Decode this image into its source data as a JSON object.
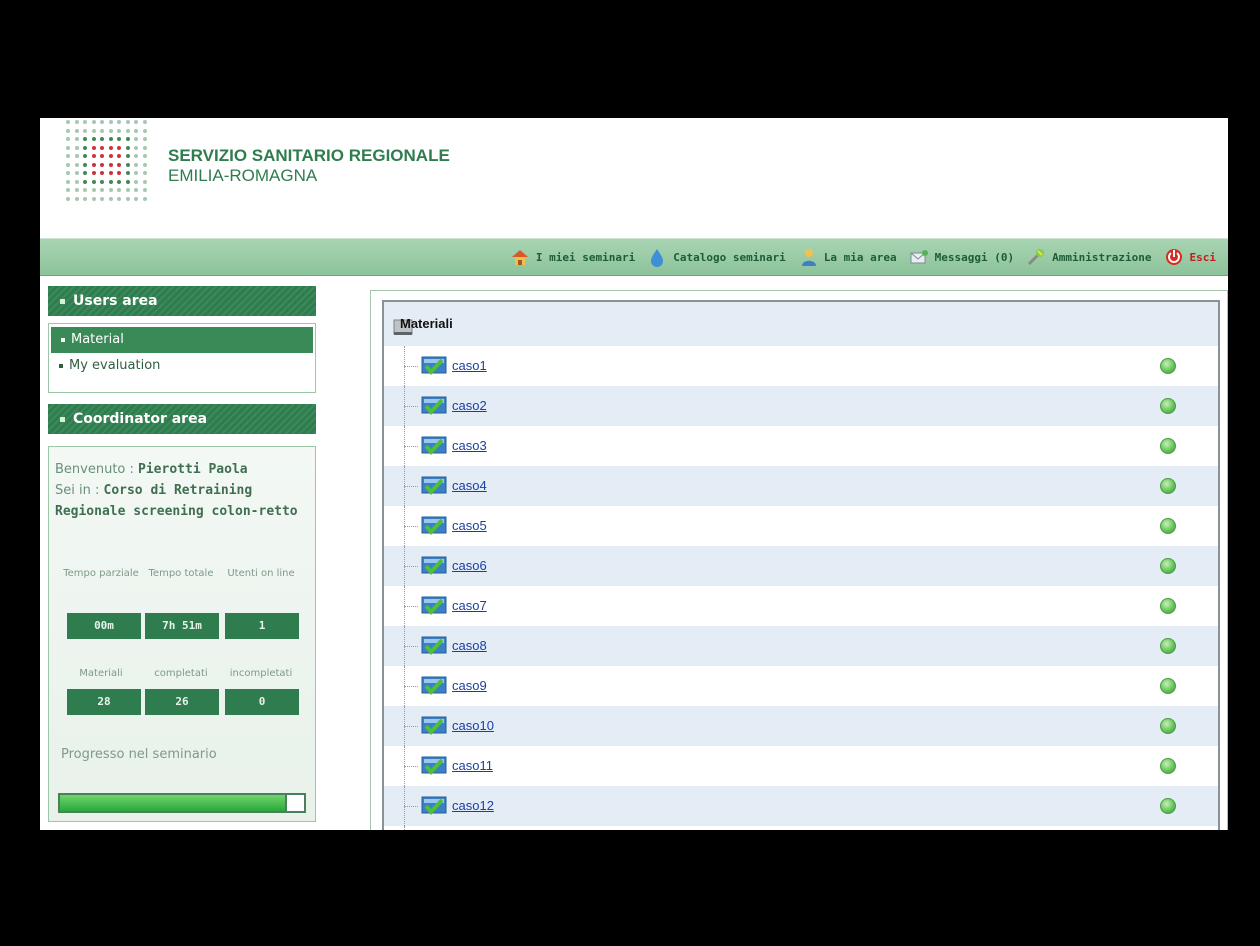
{
  "header": {
    "org_line1": "SERVIZIO SANITARIO REGIONALE",
    "org_line2": "EMILIA-ROMAGNA"
  },
  "nav": {
    "items": [
      {
        "label": "I miei seminari",
        "icon": "home-icon"
      },
      {
        "label": "Catalogo seminari",
        "icon": "catalog-drop-icon"
      },
      {
        "label": "La mia area",
        "icon": "user-area-icon"
      },
      {
        "label": "Messaggi (0)",
        "icon": "messages-icon"
      },
      {
        "label": "Amministrazione",
        "icon": "admin-tools-icon"
      },
      {
        "label": "Esci",
        "icon": "power-exit-icon"
      }
    ]
  },
  "sidebar": {
    "users_area_title": "Users area",
    "users_items": [
      {
        "label": "Material",
        "active": true
      },
      {
        "label": "My evaluation",
        "active": false
      }
    ],
    "coordinator_area_title": "Coordinator area",
    "welcome_label": "Benvenuto :",
    "welcome_name": "Pierotti Paola",
    "course_label": "Sei in :",
    "course_name": "Corso di Retraining Regionale screening colon-retto",
    "stats_time": [
      {
        "label": "Tempo parziale",
        "value": "00m"
      },
      {
        "label": "Tempo totale",
        "value": "7h 51m"
      },
      {
        "label": "Utenti on line",
        "value": "1"
      }
    ],
    "stats_materials": [
      {
        "label": "Materiali",
        "value": "28"
      },
      {
        "label": "completati",
        "value": "26"
      },
      {
        "label": "incompletati",
        "value": "0"
      }
    ],
    "progress_label": "Progresso nel seminario",
    "progress_fraction": 0.93
  },
  "materials": {
    "title": "Materiali",
    "items": [
      {
        "label": "caso1"
      },
      {
        "label": "caso2"
      },
      {
        "label": "caso3"
      },
      {
        "label": "caso4"
      },
      {
        "label": "caso5"
      },
      {
        "label": "caso6"
      },
      {
        "label": "caso7"
      },
      {
        "label": "caso8"
      },
      {
        "label": "caso9"
      },
      {
        "label": "caso10"
      },
      {
        "label": "caso11"
      },
      {
        "label": "caso12"
      },
      {
        "label": ""
      }
    ]
  },
  "colors": {
    "brand_green": "#2f7d4f",
    "status_ok": "#5ec154",
    "link_blue": "#1a3ea8",
    "exit_red": "#c0201c"
  }
}
